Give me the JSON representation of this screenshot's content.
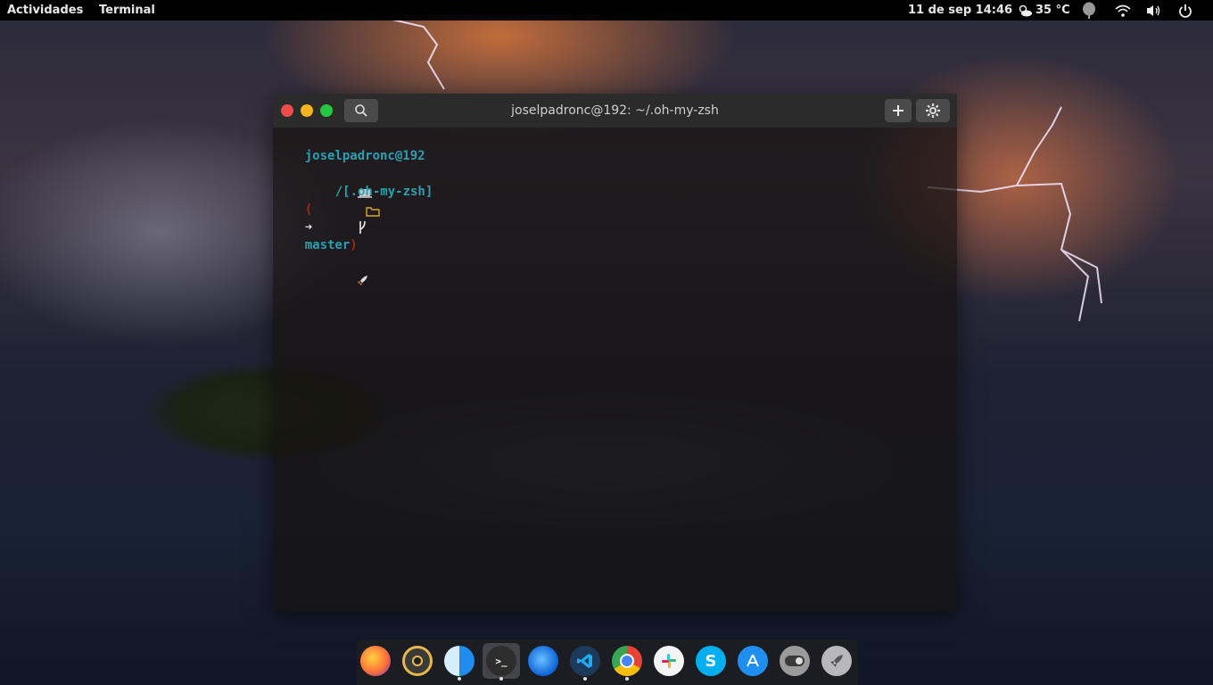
{
  "topbar": {
    "activities": "Actividades",
    "app_menu": "Terminal",
    "clock": "11 de sep  14:46",
    "temperature": "35 °C"
  },
  "terminal": {
    "title": "joselpadronc@192: ~/.oh-my-zsh",
    "prompt": {
      "user_host": "joselpadronc@192",
      "dir_open": "/[",
      "dir": ".oh-my-zsh",
      "dir_close": "]",
      "git_open": "(",
      "arrow": "➜",
      "branch": "master",
      "git_close": ")"
    }
  },
  "colors": {
    "prompt_user": "#2aa1b3",
    "prompt_dir_icon": "#d6a531",
    "prompt_git": "#a0281e",
    "close": "#ed4c48",
    "minimize": "#f4b51d",
    "maximize": "#26c841"
  },
  "dock": {
    "apps": [
      {
        "name": "firefox-icon",
        "running": false
      },
      {
        "name": "rhythmbox-icon",
        "running": false
      },
      {
        "name": "finder-icon",
        "running": true
      },
      {
        "name": "terminal-icon",
        "running": true
      },
      {
        "name": "thunderbird-icon",
        "running": false
      },
      {
        "name": "vscode-icon",
        "running": true
      },
      {
        "name": "chrome-icon",
        "running": true
      },
      {
        "name": "slack-icon",
        "running": false
      },
      {
        "name": "skype-icon",
        "running": false
      },
      {
        "name": "app-store-icon",
        "running": false
      },
      {
        "name": "tweaks-icon",
        "running": false
      },
      {
        "name": "launchpad-icon",
        "running": false
      }
    ]
  }
}
